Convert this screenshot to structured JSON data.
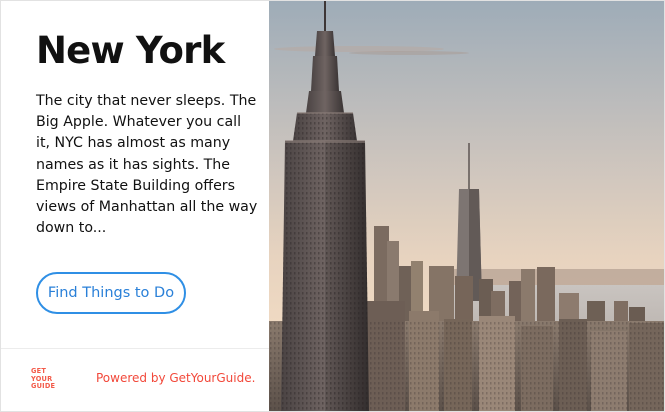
{
  "card": {
    "title": "New York",
    "description": "The city that never sleeps. The Big Apple. Whatever you call it, NYC has almost as many names as it has sights. The Empire State Building offers views of Manhattan all the way down to...",
    "cta_label": "Find Things to Do",
    "image_alt": "Empire State Building and Manhattan skyline at sunset"
  },
  "footer": {
    "logo_lines": [
      "GET",
      "YOUR",
      "GUIDE"
    ],
    "powered_by": "Powered by GetYourGuide."
  },
  "colors": {
    "accent_blue": "#2f8fe5",
    "brand_red": "#f2483a"
  }
}
